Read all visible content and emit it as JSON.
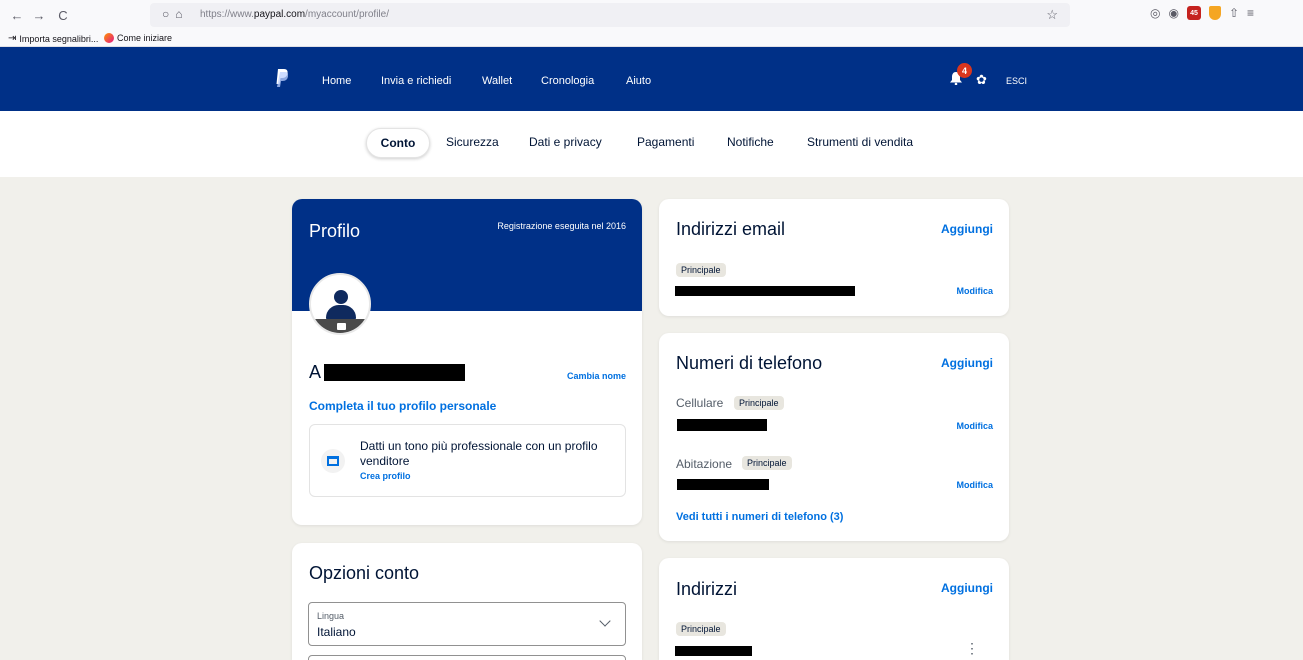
{
  "browser": {
    "back": "←",
    "forward": "→",
    "reload": "C",
    "url_prefix": "https://www.",
    "url_domain": "paypal.com",
    "url_path": "/myaccount/profile/",
    "star": "☆",
    "ext_badge_count": "45",
    "bookmarks": [
      "Importa segnalibri...",
      "Come iniziare"
    ]
  },
  "header": {
    "nav": [
      "Home",
      "Invia e richiedi",
      "Wallet",
      "Cronologia",
      "Aiuto"
    ],
    "notification_count": "4",
    "gear_glyph": "✿",
    "logout": "ESCI"
  },
  "sub_nav": {
    "tabs": [
      "Conto",
      "Sicurezza",
      "Dati e privacy",
      "Pagamenti",
      "Notifiche",
      "Strumenti di vendita"
    ]
  },
  "profile": {
    "title": "Profilo",
    "registered": "Registrazione eseguita nel 2016",
    "name_initial": "A",
    "change_name": "Cambia nome",
    "complete_profile": "Completa il tuo profilo personale",
    "seller_promo": "Datti un tono più professionale con un profilo venditore",
    "create_profile": "Crea profilo"
  },
  "options": {
    "title": "Opzioni conto",
    "language_label": "Lingua",
    "language_value": "Italiano"
  },
  "emails": {
    "title": "Indirizzi email",
    "add": "Aggiungi",
    "primary": "Principale",
    "edit": "Modifica"
  },
  "phones": {
    "title": "Numeri di telefono",
    "add": "Aggiungi",
    "mobile_label": "Cellulare",
    "home_label": "Abitazione",
    "primary": "Principale",
    "edit": "Modifica",
    "see_all": "Vedi tutti i numeri di telefono (3)"
  },
  "addresses": {
    "title": "Indirizzi",
    "add": "Aggiungi",
    "primary": "Principale",
    "more": "⋮"
  }
}
